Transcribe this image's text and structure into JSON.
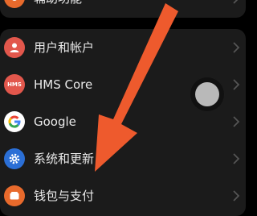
{
  "top_row": {
    "label": "辅助功能",
    "icon": "accessibility-icon",
    "icon_color": "#e86a2c"
  },
  "rows": [
    {
      "label": "用户和帐户",
      "icon": "user-icon",
      "icon_color": "#e2574c"
    },
    {
      "label": "HMS Core",
      "icon": "hms-core-icon",
      "icon_color": "#e2574c",
      "icon_text": "HMS"
    },
    {
      "label": "Google",
      "icon": "google-icon",
      "icon_color": "#ffffff"
    },
    {
      "label": "系统和更新",
      "icon": "gear-icon",
      "icon_color": "#2b6fd6"
    },
    {
      "label": "钱包与支付",
      "icon": "wallet-icon",
      "icon_color": "#e86a2c"
    }
  ],
  "annotation": {
    "arrow_color": "#ee5a2d"
  },
  "colors": {
    "background": "#000000",
    "card": "#1b1b1b",
    "text": "#e9e9e9",
    "chevron": "#555555"
  }
}
